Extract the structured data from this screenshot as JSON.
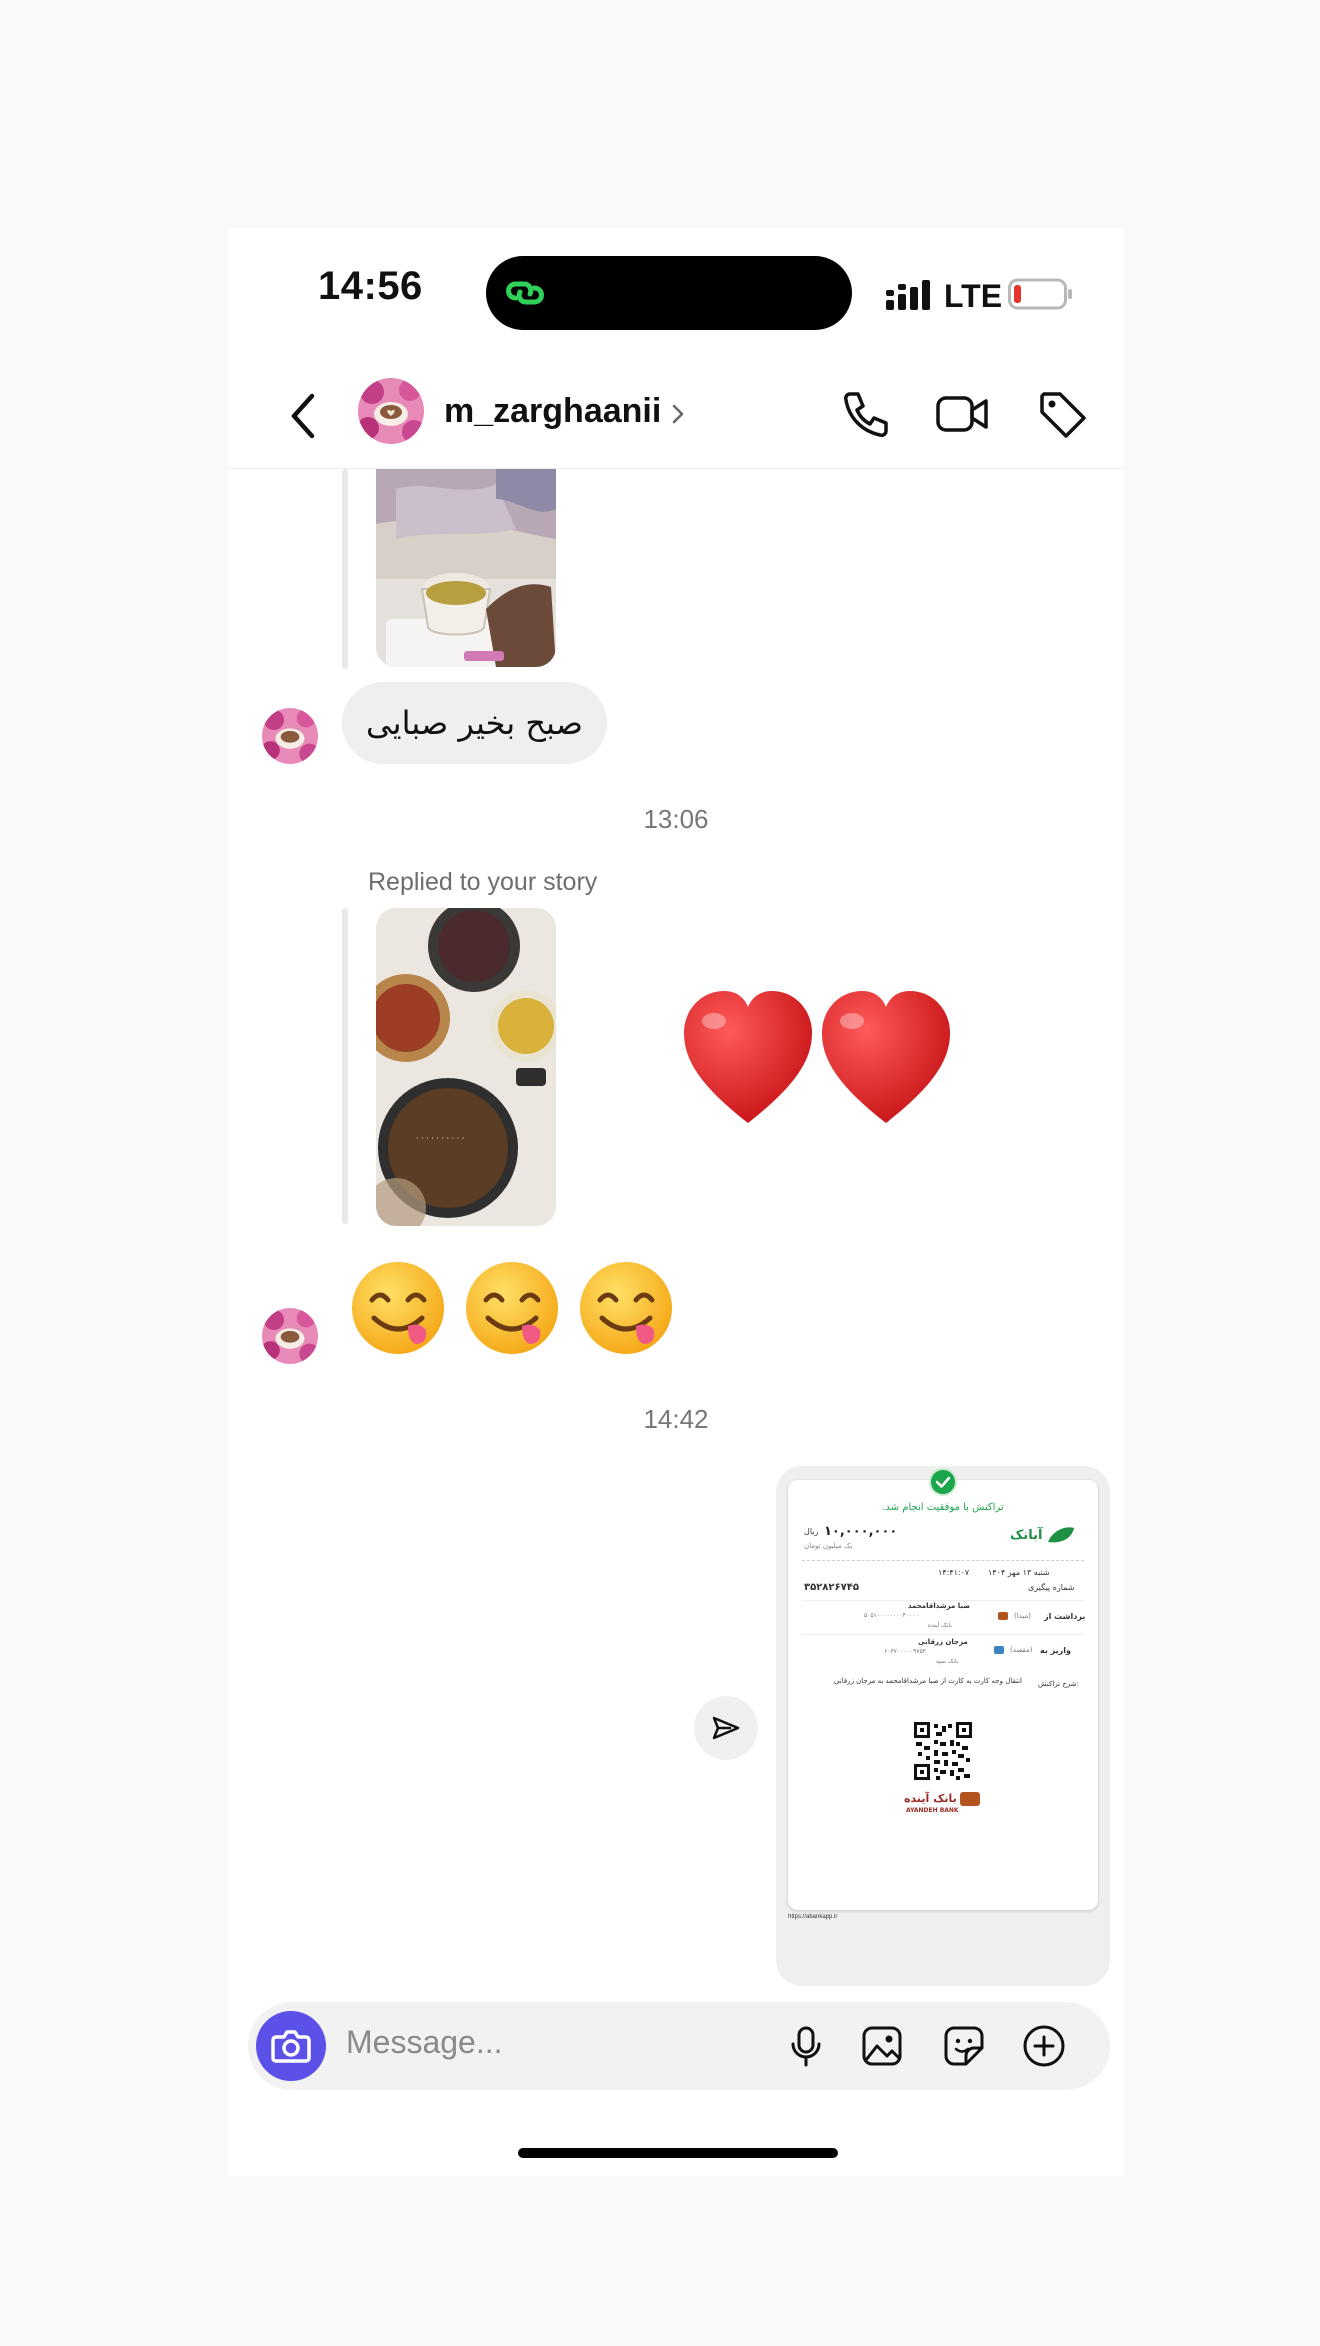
{
  "status_bar": {
    "time": "14:56",
    "network": "LTE"
  },
  "header": {
    "username": "m_zarghaanii"
  },
  "messages": {
    "greeting": "صبح بخیر صبایی",
    "time_1": "13:06",
    "replied_label": "Replied to your story",
    "emojis": [
      "😋",
      "😋",
      "😋"
    ],
    "reaction": "❤️❤️",
    "time_2": "14:42"
  },
  "receipt": {
    "success_text": "تراکنش با موفقیت انجام شد.",
    "brand": "آبانک",
    "amount": "۱۰,۰۰۰,۰۰۰",
    "currency": "ریال",
    "amount_words": "یک میلیون تومان",
    "date_label": "شنبه ۱۳ مهر ۱۴۰۴",
    "time_value": "۱۴:۴۱:۰۷",
    "tracking_label": "شماره پیگیری",
    "tracking_value": "۳۵۲۸۲۶۷۴۵",
    "from_label": "برداشت از",
    "from_sub": "(مبدا)",
    "from_name": "صبا مرشداقامحمد",
    "from_bank": "بانک آینده",
    "to_label": "واریز به",
    "to_sub": "(مقصد)",
    "to_name": "مرجان زرقانی",
    "to_bank": "بانک سپه",
    "desc_label": "شرح تراکنش:",
    "desc_value": "انتقال وجه کارت به کارت از صبا مرشداقامحمد به مرجان زرقانی",
    "bank_logo_fa": "بانک آینده",
    "bank_logo_en": "AYANDEH BANK",
    "url": "https://abankapp.ir"
  },
  "composer": {
    "placeholder": "Message..."
  },
  "colors": {
    "camera_button": "#5b51e8",
    "bubble_bg": "#efefef",
    "accent_green": "#1aa64a"
  }
}
